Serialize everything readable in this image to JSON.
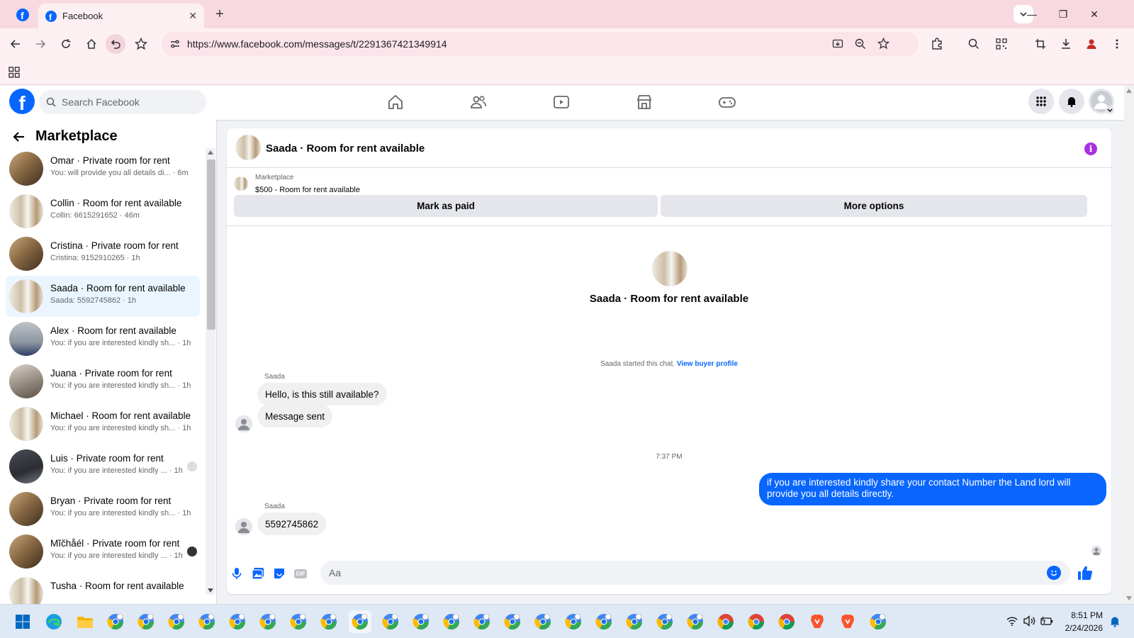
{
  "browser": {
    "tab_title": "Facebook",
    "url": "https://www.facebook.com/messages/t/2291367421349914"
  },
  "fb_header": {
    "logo_letter": "f",
    "search_placeholder": "Search Facebook"
  },
  "left_panel": {
    "title": "Marketplace",
    "conversations": [
      {
        "name": "Omar · Private room for rent",
        "preview": "You: will provide you all details di... · 6m",
        "img": "room"
      },
      {
        "name": "Collin · Room for rent available",
        "preview": "Collin: 6615291652 · 46m",
        "img": "white"
      },
      {
        "name": "Cristina · Private room for rent",
        "preview": "Cristina: 9152910265 · 1h",
        "img": "room"
      },
      {
        "name": "Saada · Room for rent available",
        "preview": "Saada: 5592745862 · 1h",
        "img": "white",
        "selected": true
      },
      {
        "name": "Alex · Room for rent available",
        "preview": "You: if you are interested kindly sh... · 1h",
        "img": "gray"
      },
      {
        "name": "Juana · Private room for rent",
        "preview": "You: if you are interested kindly sh... · 1h",
        "img": "sofa"
      },
      {
        "name": "Michael · Room for rent available",
        "preview": "You: if you are interested kindly sh... · 1h",
        "img": "white"
      },
      {
        "name": "Luis · Private room for rent",
        "preview": "You: if you are interested kindly ... · 1h",
        "img": "dark"
      },
      {
        "name": "Bryan · Private room for rent",
        "preview": "You: if you are interested kindly sh... · 1h",
        "img": "room"
      },
      {
        "name": "Mĭčhåél · Private room for rent",
        "preview": "You: if you are interested kindly ... · 1h",
        "img": "room"
      },
      {
        "name": "Tusha · Room for rent available",
        "preview": "",
        "img": "white"
      }
    ]
  },
  "chat": {
    "header_title": "Saada · Room for rent available",
    "listing_label": "Marketplace",
    "listing_price": "$500 - Room for rent available",
    "mark_paid_label": "Mark as paid",
    "more_options_label": "More options",
    "intro_title": "Saada · Room for rent available",
    "started_text": "Saada started this chat.",
    "view_profile_link": "View buyer profile",
    "sender_name": "Saada",
    "messages_in_1": [
      "Hello, is this still available?",
      "Message sent"
    ],
    "timestamp": "7:37 PM",
    "message_out": "if you are interested kindly share your contact Number the Land lord will provide you all details directly.",
    "message_in_2": "5592745862",
    "composer_placeholder": "Aa",
    "gif_label": "GIF"
  },
  "taskbar": {
    "time": "8:51 PM",
    "date": "2/24/2026"
  },
  "colors": {
    "fb_blue": "#0866ff",
    "tab_bar": "#f9d9e0",
    "selected_conv": "#ebf5ff",
    "info_purple": "#a933e0"
  }
}
